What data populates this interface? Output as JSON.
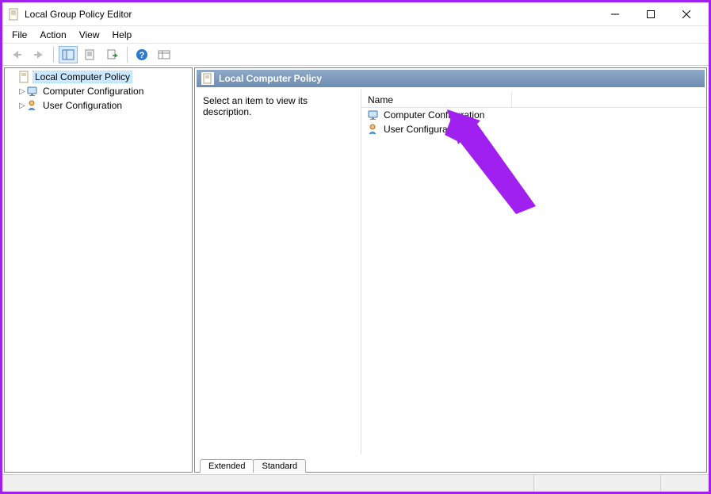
{
  "window": {
    "title": "Local Group Policy Editor"
  },
  "menu": {
    "items": [
      "File",
      "Action",
      "View",
      "Help"
    ]
  },
  "tree": {
    "root": {
      "label": "Local Computer Policy"
    },
    "children": [
      {
        "label": "Computer Configuration"
      },
      {
        "label": "User Configuration"
      }
    ]
  },
  "content": {
    "header": "Local Computer Policy",
    "desc": "Select an item to view its description.",
    "columns": {
      "name": "Name"
    },
    "items": [
      {
        "label": "Computer Configuration"
      },
      {
        "label": "User Configuration"
      }
    ]
  },
  "tabs": {
    "extended": "Extended",
    "standard": "Standard"
  }
}
